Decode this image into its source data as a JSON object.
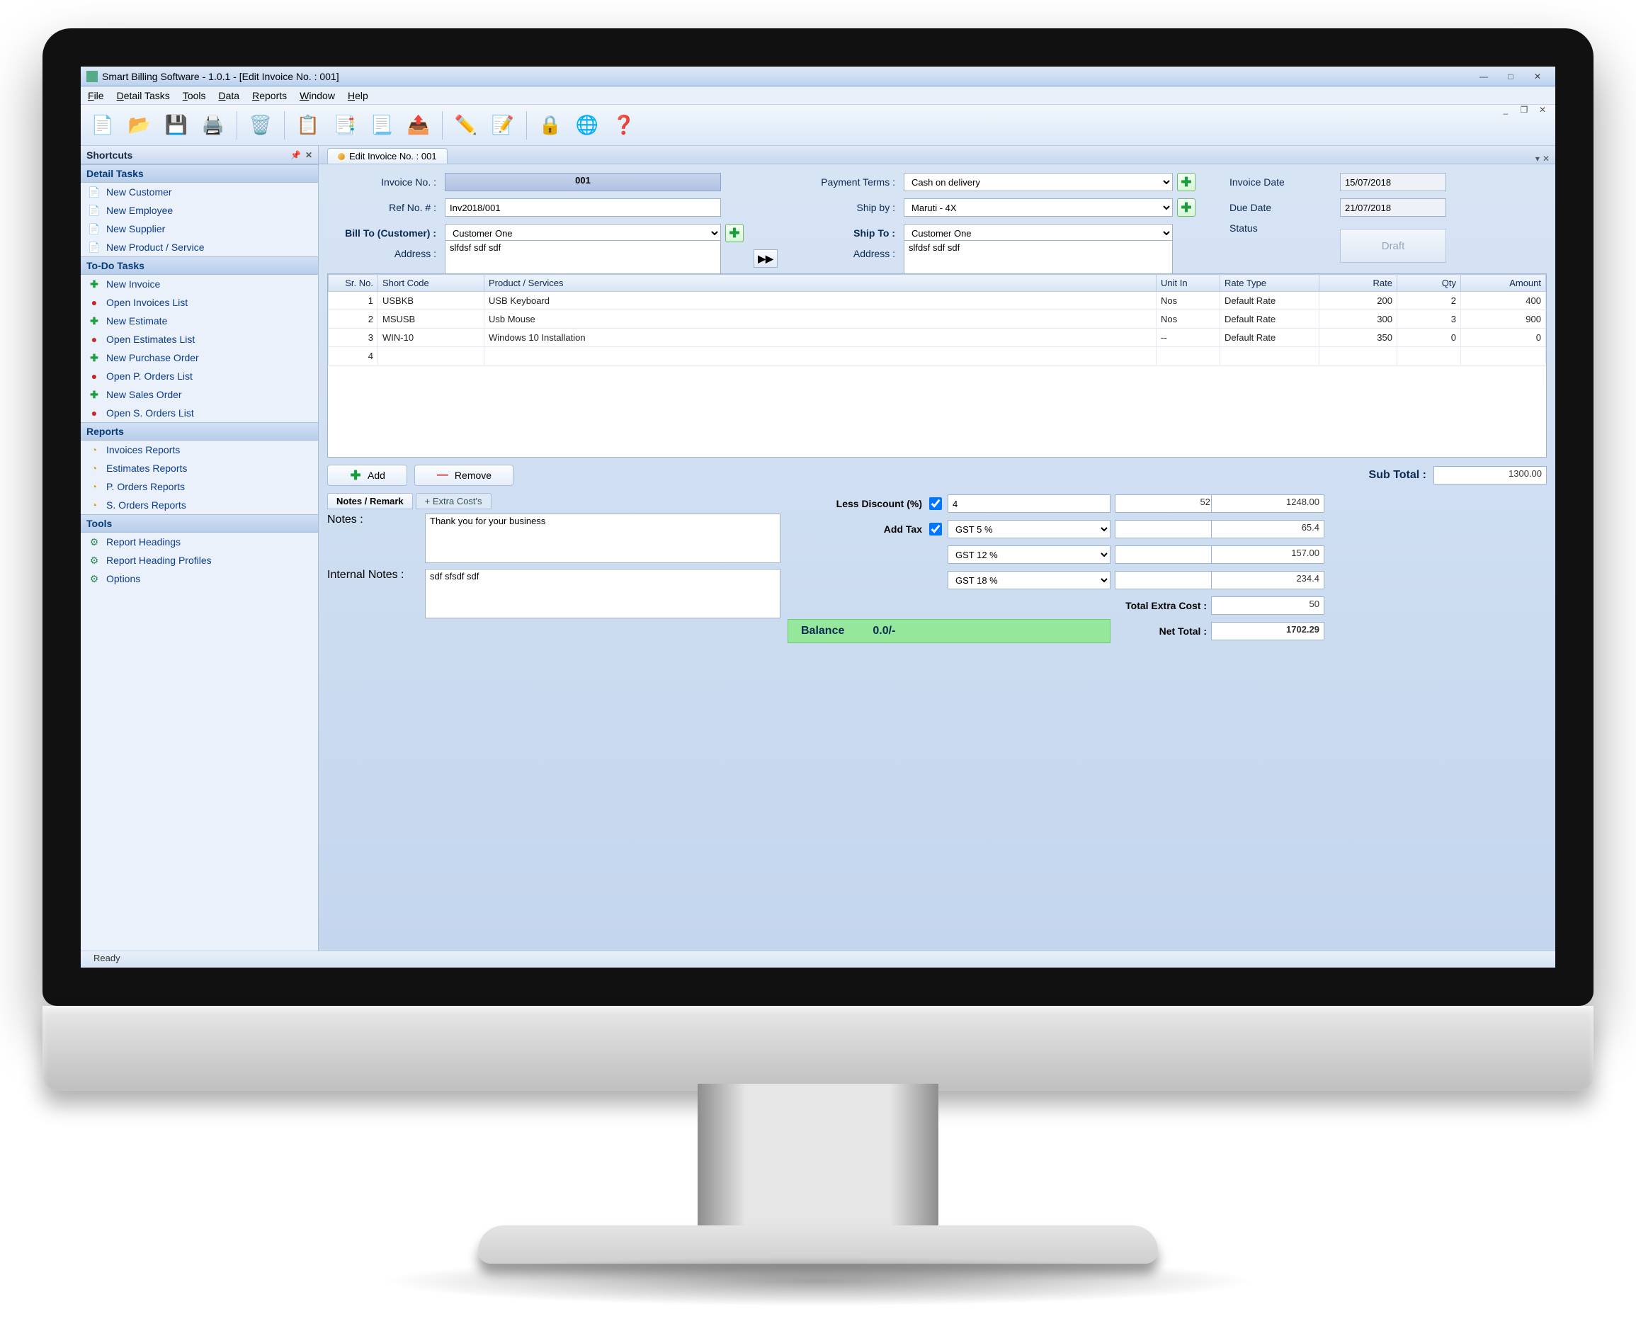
{
  "title": "Smart Billing Software - 1.0.1 - [Edit Invoice No. : 001]",
  "menu": [
    "File",
    "Detail Tasks",
    "Tools",
    "Data",
    "Reports",
    "Window",
    "Help"
  ],
  "sidePanel": {
    "title": "Shortcuts",
    "groups": [
      {
        "title": "Detail Tasks",
        "items": [
          {
            "icon": "doc",
            "label": "New Customer"
          },
          {
            "icon": "doc",
            "label": "New Employee"
          },
          {
            "icon": "doc",
            "label": "New Supplier"
          },
          {
            "icon": "doc",
            "label": "New Product / Service"
          }
        ]
      },
      {
        "title": "To-Do Tasks",
        "items": [
          {
            "icon": "plus",
            "label": "New Invoice"
          },
          {
            "icon": "red",
            "label": "Open Invoices List"
          },
          {
            "icon": "plus",
            "label": "New Estimate"
          },
          {
            "icon": "red",
            "label": "Open Estimates List"
          },
          {
            "icon": "plus",
            "label": "New Purchase Order"
          },
          {
            "icon": "red",
            "label": "Open P. Orders List"
          },
          {
            "icon": "plus",
            "label": "New Sales Order"
          },
          {
            "icon": "red",
            "label": "Open S. Orders List"
          }
        ]
      },
      {
        "title": "Reports",
        "items": [
          {
            "icon": "yel",
            "label": "Invoices Reports"
          },
          {
            "icon": "yel",
            "label": "Estimates Reports"
          },
          {
            "icon": "yel",
            "label": "P. Orders Reports"
          },
          {
            "icon": "yel",
            "label": "S. Orders Reports"
          }
        ]
      },
      {
        "title": "Tools",
        "items": [
          {
            "icon": "gear",
            "label": "Report Headings"
          },
          {
            "icon": "gear",
            "label": "Report Heading Profiles"
          },
          {
            "icon": "gear",
            "label": "Options"
          }
        ]
      }
    ]
  },
  "tab": {
    "label": "Edit Invoice No. : 001"
  },
  "form": {
    "invoiceNoLabel": "Invoice No. :",
    "invoiceNo": "001",
    "refLabel": "Ref No. # :",
    "ref": "Inv2018/001",
    "billToLabel": "Bill To (Customer) :",
    "billTo": "Customer One",
    "addressLabel": "Address :",
    "address": "slfdsf sdf sdf",
    "payTermsLabel": "Payment Terms :",
    "payTerms": "Cash on delivery",
    "shipByLabel": "Ship by :",
    "shipBy": "Maruti - 4X",
    "shipToLabel": "Ship To :",
    "shipTo": "Customer One",
    "shipAddrLabel": "Address :",
    "shipAddr": "slfdsf sdf sdf",
    "invoiceDateLabel": "Invoice Date",
    "invoiceDate": "15/07/2018",
    "dueDateLabel": "Due Date",
    "dueDate": "21/07/2018",
    "statusLabel": "Status",
    "statusValue": "Draft"
  },
  "cols": {
    "sr": "Sr. No.",
    "short": "Short Code",
    "prod": "Product / Services",
    "unit": "Unit In",
    "rateType": "Rate Type",
    "rate": "Rate",
    "qty": "Qty",
    "amt": "Amount"
  },
  "rows": [
    {
      "sr": "1",
      "short": "USBKB",
      "prod": "USB Keyboard",
      "unit": "Nos",
      "rateType": "Default Rate",
      "rate": "200",
      "qty": "2",
      "amt": "400"
    },
    {
      "sr": "2",
      "short": "MSUSB",
      "prod": "Usb Mouse",
      "unit": "Nos",
      "rateType": "Default Rate",
      "rate": "300",
      "qty": "3",
      "amt": "900"
    },
    {
      "sr": "3",
      "short": "WIN-10",
      "prod": "Windows 10 Installation",
      "unit": "--",
      "rateType": "Default Rate",
      "rate": "350",
      "qty": "0",
      "amt": "0"
    },
    {
      "sr": "4",
      "short": "",
      "prod": "",
      "unit": "",
      "rateType": "",
      "rate": "",
      "qty": "",
      "amt": ""
    }
  ],
  "btns": {
    "add": "Add",
    "remove": "Remove"
  },
  "totals": {
    "subLabel": "Sub Total :",
    "sub": "1300.00",
    "discLabel": "Less Discount (%)",
    "discPct": "4",
    "discAmt": "52.00",
    "discTotal": "1248.00",
    "addTaxLabel": "Add Tax",
    "tax1Name": "GST 5 %",
    "tax1Rate": "5",
    "tax1Amt": "65.4",
    "tax2Name": "GST 12 %",
    "tax2Rate": "12",
    "tax2Amt": "157.00",
    "tax3Name": "GST 18 %",
    "tax3Rate": "18",
    "tax3Amt": "234.4",
    "extraLabel": "Total Extra Cost :",
    "extra": "50",
    "netLabel": "Net Total :",
    "net": "1702.29",
    "balLabel": "Balance",
    "bal": "0.0/-"
  },
  "notes": {
    "tab1": "Notes / Remark",
    "tab2": "+ Extra Cost's",
    "notesLabel": "Notes :",
    "notes": "Thank you for your business",
    "internalLabel": "Internal Notes :",
    "internal": "sdf sfsdf sdf"
  },
  "status": "Ready"
}
